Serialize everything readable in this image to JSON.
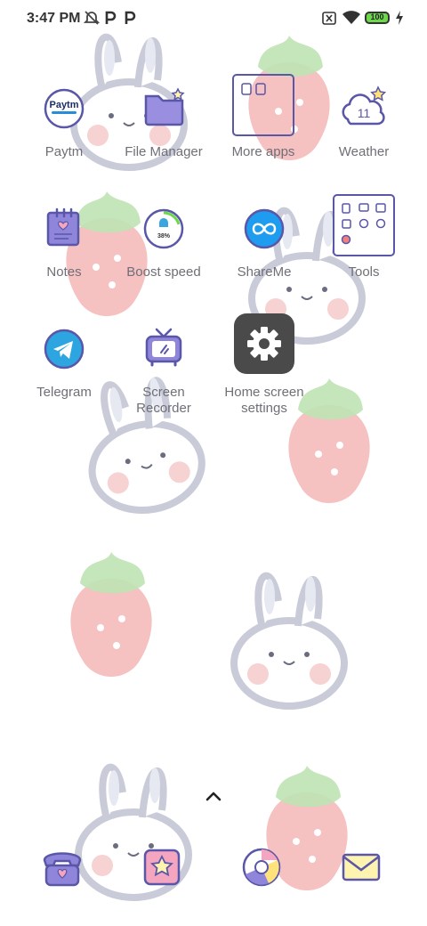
{
  "status_bar": {
    "time": "3:47 PM",
    "battery_level": "100",
    "icons": [
      "alarm-off-icon",
      "paytm-notification-icon",
      "paytm-notification-icon",
      "sim-no-service-icon",
      "wifi-icon",
      "battery-icon",
      "charging-icon"
    ]
  },
  "apps": [
    {
      "label": "Paytm",
      "icon": "paytm-icon",
      "paytm_text": "Paytm"
    },
    {
      "label": "File Manager",
      "icon": "file-manager-icon"
    },
    {
      "label": "More apps",
      "icon": "more-apps-folder-icon"
    },
    {
      "label": "Weather",
      "icon": "weather-icon",
      "temp": "11"
    },
    {
      "label": "Notes",
      "icon": "notes-icon"
    },
    {
      "label": "Boost speed",
      "icon": "boost-speed-icon",
      "percent": "38%"
    },
    {
      "label": "ShareMe",
      "icon": "shareme-icon"
    },
    {
      "label": "Tools",
      "icon": "tools-folder-icon"
    },
    {
      "label": "Telegram",
      "icon": "telegram-icon"
    },
    {
      "label": "Screen Recorder",
      "label_line1": "Screen",
      "label_line2": "Recorder",
      "icon": "screen-recorder-icon"
    },
    {
      "label": "Home screen settings",
      "label_line1": "Home screen",
      "label_line2": "settings",
      "icon": "settings-gear-icon"
    }
  ],
  "dock": [
    "phone-icon",
    "star-gallery-icon",
    "browser-icon",
    "messages-envelope-icon"
  ],
  "colors": {
    "accent_purple": "#5a56a8",
    "strawberry_pink": "#f3b6b6",
    "leaf_green": "#bfe3b4",
    "bunny_outline": "#c9cbd8",
    "label_gray": "#6f6f77",
    "battery_green": "#6cd94b"
  }
}
